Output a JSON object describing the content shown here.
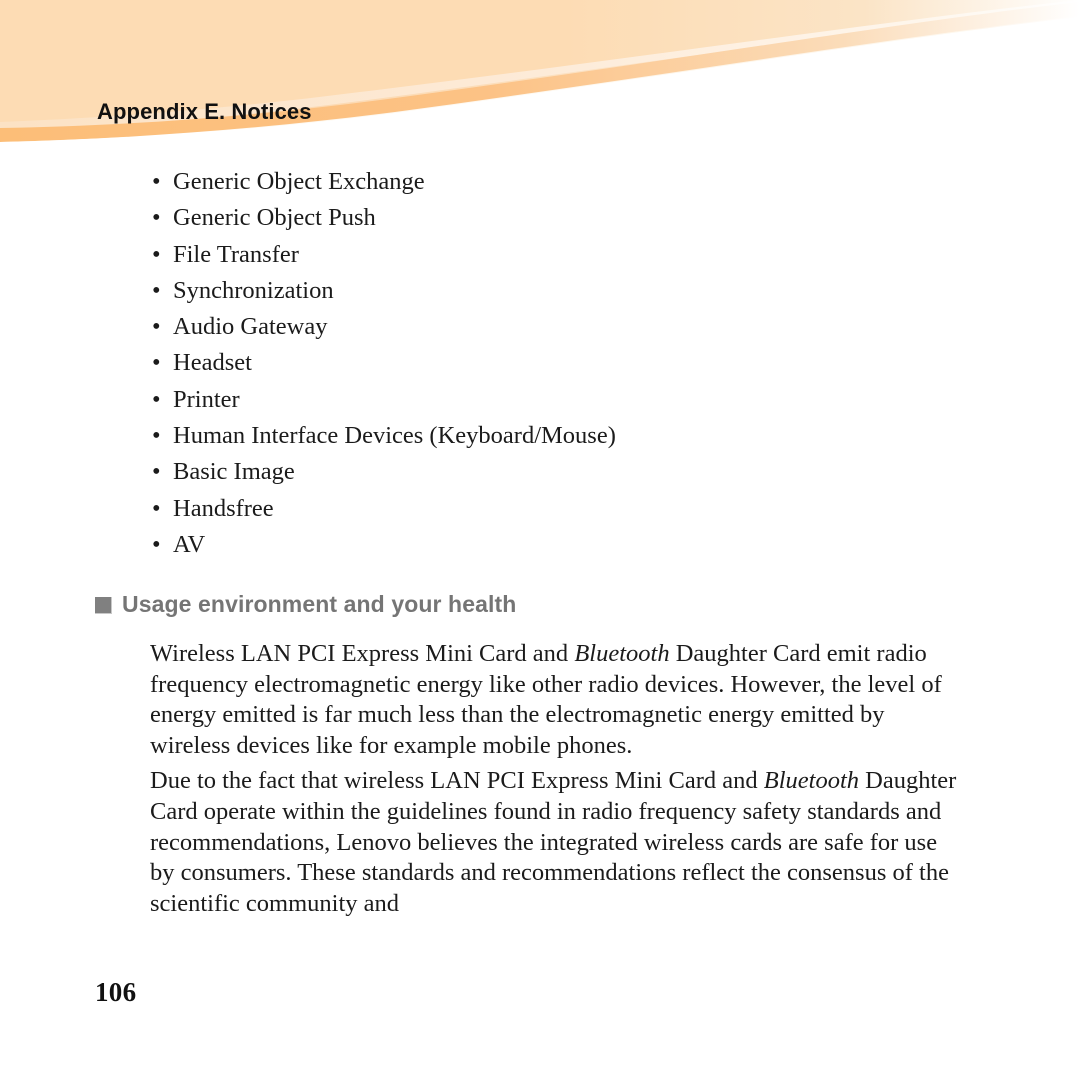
{
  "document": {
    "header": {
      "title": "Appendix E. Notices",
      "banner_colors": {
        "base_peach": "#FDDCB4",
        "band_orange": "#FCBE78",
        "ribbon_light": "#FCE7CE",
        "ribbon_pale": "#FDF3E7",
        "page_white": "#FFFFFF"
      }
    },
    "feature_list": {
      "bullet_glyph": "•",
      "items": [
        "Generic Object Exchange",
        "Generic Object Push",
        "File Transfer",
        "Synchronization",
        "Audio Gateway",
        "Headset",
        "Printer",
        "Human Interface Devices (Keyboard/Mouse)",
        "Basic Image",
        "Handsfree",
        "AV"
      ]
    },
    "section": {
      "marker_glyph": "square",
      "marker_color": "#808080",
      "heading": "Usage environment and your health",
      "heading_color": "#757575"
    },
    "paragraphs": [
      {
        "id": "para-first",
        "runs": [
          {
            "text": "Wireless LAN PCI Express Mini Card and ",
            "style": "normal"
          },
          {
            "text": "Bluetooth",
            "style": "italic"
          },
          {
            "text": " Daughter Card emit radio frequency electromagnetic energy like other radio devices. However, the level of energy emitted is far much less than the electromagnetic energy emitted by wireless devices like for example mobile phones.",
            "style": "normal"
          }
        ]
      },
      {
        "id": "para-second",
        "runs": [
          {
            "text": "Due to the fact that wireless LAN PCI Express Mini Card and ",
            "style": "normal"
          },
          {
            "text": "Bluetooth",
            "style": "italic"
          },
          {
            "text": " Daughter Card operate within the guidelines found in radio frequency safety standards and recommendations, Lenovo believes the integrated wireless cards are safe for use by consumers. These standards and recommendations reflect the consensus of the scientific community and",
            "style": "normal"
          }
        ]
      }
    ],
    "footer": {
      "page_number": "106"
    }
  }
}
